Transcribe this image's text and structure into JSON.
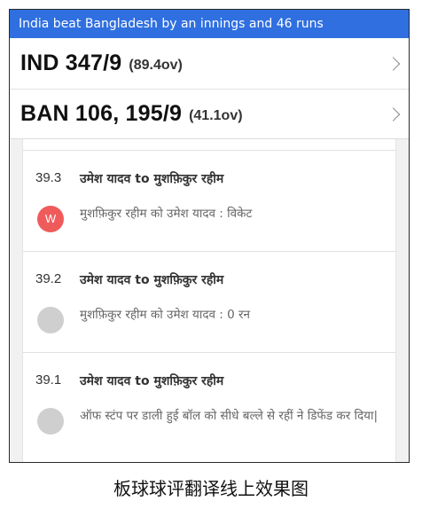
{
  "banner": {
    "text": "India beat Bangladesh by an innings and 46 runs"
  },
  "scores": [
    {
      "team_score": "IND 347/9",
      "overs": "(89.4ov)"
    },
    {
      "team_score": "BAN 106, 195/9",
      "overs": "(41.1ov)"
    }
  ],
  "commentary": [
    {
      "over": "39.3",
      "head": "उमेश यादव to मुशफ़िकुर रहीम",
      "badge": "W",
      "desc": "मुशफ़िकुर रहीम को उमेश यादव : विकेट"
    },
    {
      "over": "39.2",
      "head": "उमेश यादव to मुशफ़िकुर रहीम",
      "badge": "",
      "desc": "मुशफ़िकुर रहीम को उमेश यादव : 0 रन"
    },
    {
      "over": "39.1",
      "head": "उमेश यादव to मुशफ़िकुर रहीम",
      "badge": "",
      "desc": "ऑफ स्टंप पर डाली हुई बॉल को सीधे बल्ले से रहीं ने डिफेंड कर दिया|"
    }
  ],
  "caption": "板球球评翻译线上效果图",
  "colors": {
    "banner": "#2f6fe0",
    "wicket": "#ef5b5b",
    "dot": "#cfcfcf"
  }
}
